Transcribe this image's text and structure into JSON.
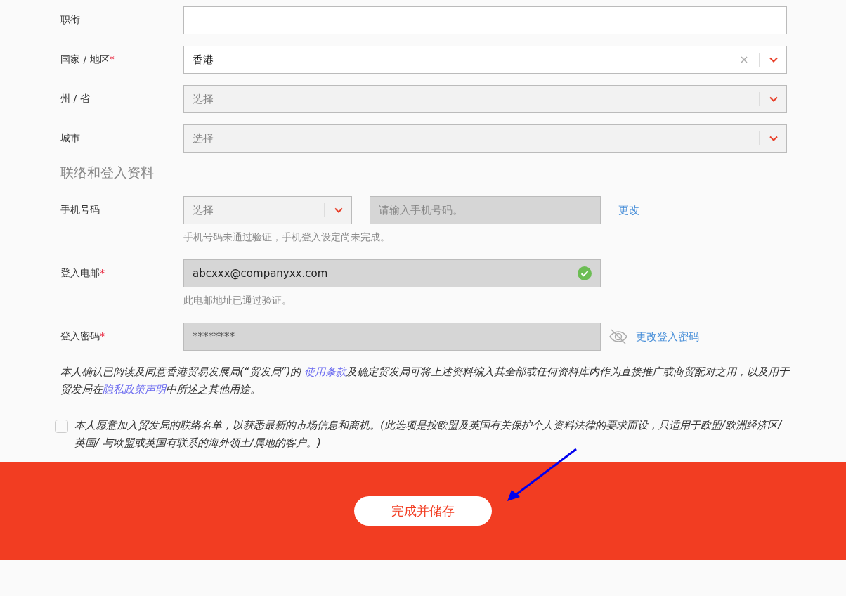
{
  "fields": [
    {
      "label": "职衔",
      "kind": "text"
    },
    {
      "label": "国家 / 地区",
      "required_mark": "*",
      "kind": "select",
      "value": "香港",
      "clearable": true,
      "disabled": false
    },
    {
      "label": "州 / 省",
      "kind": "select",
      "placeholder": "选择",
      "disabled": true
    },
    {
      "label": "城市",
      "kind": "select",
      "placeholder": "选择",
      "disabled": true
    }
  ],
  "section_title": "联络和登入资料",
  "phone": {
    "label": "手机号码",
    "code_placeholder": "选择",
    "number_placeholder": "请输入手机号码。",
    "link": "更改",
    "note": "手机号码未通过验证，手机登入设定尚未完成。"
  },
  "email": {
    "label": "登入电邮",
    "required_mark": "*",
    "value": "abcxxx@companyxx.com",
    "verified": true,
    "note": "此电邮地址已通过验证。"
  },
  "password": {
    "label": "登入密码",
    "required_mark": "*",
    "value": "********",
    "link": "更改登入密码"
  },
  "consent": [
    {
      "text": "本人确认已阅读及同意香港贸易发展局(“贸发局”)的 ",
      "kind": "text"
    },
    {
      "text": "使用条款",
      "kind": "link"
    },
    {
      "text": "及确定贸发局可将上述资料编入其全部或任何资料库内作为直接推广或商贸配对之用，以及用于贸发局在",
      "kind": "text"
    },
    {
      "text": "隐私政策声明",
      "kind": "link"
    },
    {
      "text": "中所述之其他用途。",
      "kind": "text"
    }
  ],
  "opt_in": {
    "checked": false,
    "text": "本人愿意加入贸发局的联络名单，以获悉最新的市场信息和商机。(此选项是按欧盟及英国有关保护个人资料法律的要求而设，只适用于欧盟/欧洲经济区/英国/ 与欧盟或英国有联系的海外领土/属地的客户。)"
  },
  "submit": "完成并储存"
}
